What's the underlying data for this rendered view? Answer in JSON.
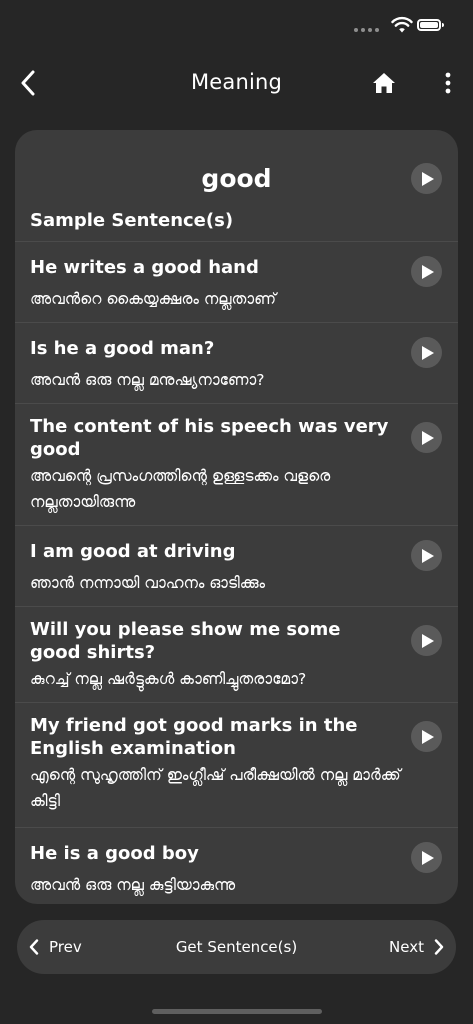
{
  "status_bar": {
    "icons": [
      "signal-dots",
      "wifi-icon",
      "battery-icon"
    ]
  },
  "nav": {
    "title": "Meaning",
    "back_icon": "chevron-left-icon",
    "home_icon": "home-icon",
    "more_icon": "more-vertical-icon"
  },
  "card": {
    "word": "good",
    "section_heading": "Sample Sentence(s)",
    "sentences": [
      {
        "en": "He writes a good hand",
        "ml": "അവൻറെ കൈയ്യക്ഷരം നല്ലതാണ്"
      },
      {
        "en": "Is he a good man?",
        "ml": "അവൻ ഒരു നല്ല മനുഷ്യനാണോ?"
      },
      {
        "en": "The content of his speech was very good",
        "ml": "അവന്റെ പ്രസംഗത്തിന്റെ ഉള്ളടക്കം വളരെ നല്ലതായിരുന്നു"
      },
      {
        "en": "I am good at driving",
        "ml": "ഞാൻ നന്നായി വാഹനം ഓടിക്കും"
      },
      {
        "en": "Will you please show me some good shirts?",
        "ml": "കുറച്ച് നല്ല ഷർട്ടുകൾ കാണിച്ചുതരാമോ?"
      },
      {
        "en": "My friend got good marks in the English examination",
        "ml": "എന്റെ സുഹൃത്തിന് ഇംഗ്ലീഷ് പരീക്ഷയിൽ നല്ല മാർക്ക് കിട്ടി"
      },
      {
        "en": "He is a good boy",
        "ml": "അവൻ ഒരു നല്ല കുട്ടിയാകുന്നു"
      }
    ]
  },
  "bottom_bar": {
    "prev_label": "Prev",
    "get_label": "Get Sentence(s)",
    "next_label": "Next"
  },
  "colors": {
    "background": "#262626",
    "card": "#3c3c3c",
    "play_button": "#5a5a5a",
    "text": "#ffffff"
  }
}
